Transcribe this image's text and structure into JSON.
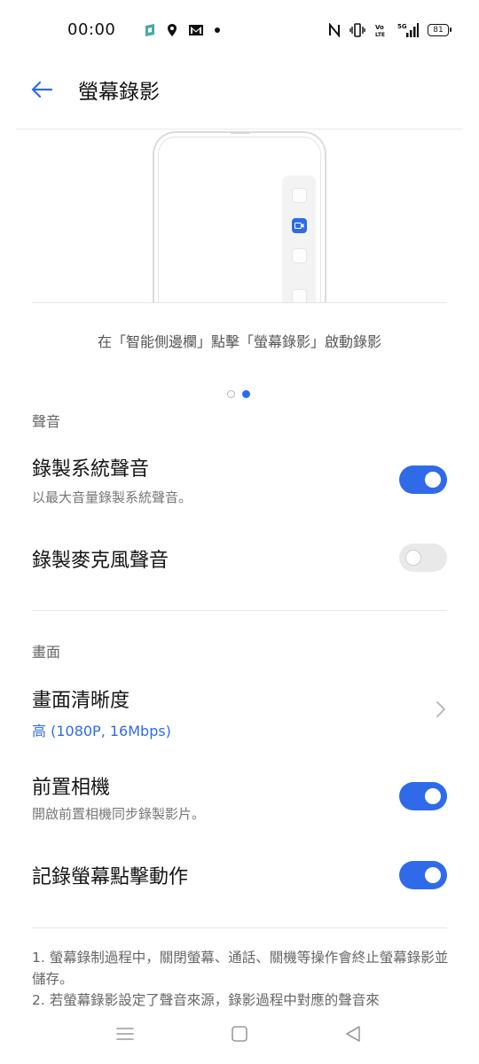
{
  "status_bar": {
    "time": "00:00",
    "left_icons": [
      "app-notification-icon",
      "location-icon",
      "gmail-icon",
      "dot-icon"
    ],
    "right_icons": [
      "nfc-icon",
      "vibrate-icon",
      "volte-icon",
      "5g-signal-icon"
    ],
    "battery": "81"
  },
  "header": {
    "title": "螢幕錄影",
    "back_icon": "arrow-left-icon"
  },
  "illustration": {
    "caption": "在「智能側邊欄」點擊「螢幕錄影」啟動錄影",
    "page_count": 2,
    "active_page": 2
  },
  "sections": {
    "audio": {
      "header": "聲音",
      "system_audio": {
        "title": "錄製系統聲音",
        "subtitle": "以最大音量錄製系統聲音。",
        "enabled": true
      },
      "mic_audio": {
        "title": "錄製麥克風聲音",
        "enabled": false,
        "disabled_state": true
      }
    },
    "video": {
      "header": "畫面",
      "resolution": {
        "title": "畫面清晰度",
        "value": "高 (1080P, 16Mbps)"
      },
      "front_camera": {
        "title": "前置相機",
        "subtitle": "開啟前置相機同步錄製影片。",
        "enabled": true
      },
      "touch_record": {
        "title": "記錄螢幕點擊動作",
        "enabled": true
      }
    }
  },
  "notes": {
    "line1": "1. 螢幕錄制過程中，關閉螢幕、通話、關機等操作會終止螢幕錄影並儲存。",
    "line2": "2. 若螢幕錄影設定了聲音來源，錄影過程中對應的聲音來"
  },
  "colors": {
    "accent": "#2f6be8",
    "toggle_off": "#e9e9e9",
    "secondary_text": "#777777"
  },
  "nav_bar": {
    "icons": [
      "menu-icon",
      "home-icon",
      "back-triangle-icon"
    ]
  }
}
